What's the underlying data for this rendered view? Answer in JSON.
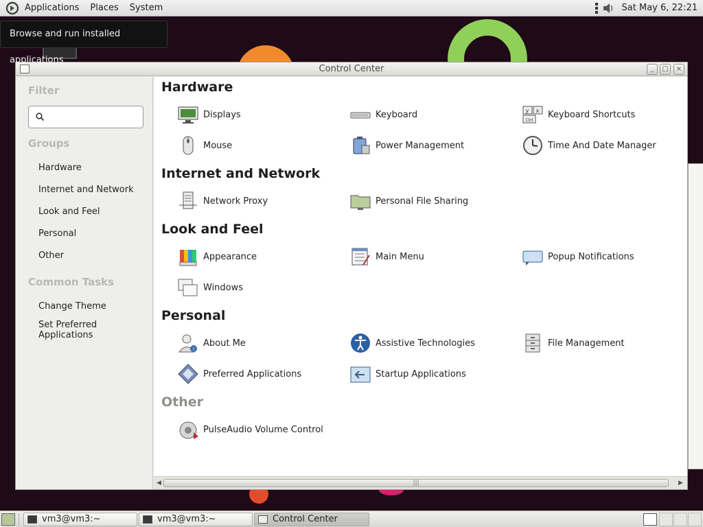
{
  "top_panel": {
    "menus": [
      "Applications",
      "Places",
      "System"
    ],
    "clock": "Sat May  6, 22:21"
  },
  "tooltip": "Browse and run installed applications",
  "window": {
    "title": "Control Center",
    "sidebar": {
      "filter_heading": "Filter",
      "search_value": "",
      "groups_heading": "Groups",
      "groups": [
        "Hardware",
        "Internet and Network",
        "Look and Feel",
        "Personal",
        "Other"
      ],
      "tasks_heading": "Common Tasks",
      "tasks": [
        "Change Theme",
        "Set Preferred\nApplications"
      ]
    },
    "sections": [
      {
        "title": "Hardware",
        "items": [
          {
            "label": "Displays",
            "icon": "monitor-icon"
          },
          {
            "label": "Keyboard",
            "icon": "keyboard-icon"
          },
          {
            "label": "Keyboard Shortcuts",
            "icon": "shortcuts-icon"
          },
          {
            "label": "Mouse",
            "icon": "mouse-icon"
          },
          {
            "label": "Power Management",
            "icon": "battery-icon"
          },
          {
            "label": "Time And Date Manager",
            "icon": "clock-icon"
          }
        ]
      },
      {
        "title": "Internet and Network",
        "items": [
          {
            "label": "Network Proxy",
            "icon": "proxy-icon"
          },
          {
            "label": "Personal File Sharing",
            "icon": "folder-share-icon"
          }
        ]
      },
      {
        "title": "Look and Feel",
        "items": [
          {
            "label": "Appearance",
            "icon": "palette-icon"
          },
          {
            "label": "Main Menu",
            "icon": "menu-icon"
          },
          {
            "label": "Popup Notifications",
            "icon": "notification-icon"
          },
          {
            "label": "Windows",
            "icon": "windows-icon"
          }
        ]
      },
      {
        "title": "Personal",
        "items": [
          {
            "label": "About Me",
            "icon": "user-icon"
          },
          {
            "label": "Assistive Technologies",
            "icon": "accessibility-icon"
          },
          {
            "label": "File Management",
            "icon": "file-cabinet-icon"
          },
          {
            "label": "Preferred Applications",
            "icon": "preferred-apps-icon"
          },
          {
            "label": "Startup Applications",
            "icon": "startup-icon"
          }
        ]
      },
      {
        "title": "Other",
        "items": [
          {
            "label": "PulseAudio Volume Control",
            "icon": "speaker-icon"
          }
        ]
      }
    ]
  },
  "taskbar": {
    "tasks": [
      "vm3@vm3:~",
      "vm3@vm3:~",
      "Control Center"
    ]
  },
  "colors": {
    "panel": "#dcdcdc",
    "desktop": "#1f0a17",
    "section_dim": "#8f8f88"
  }
}
